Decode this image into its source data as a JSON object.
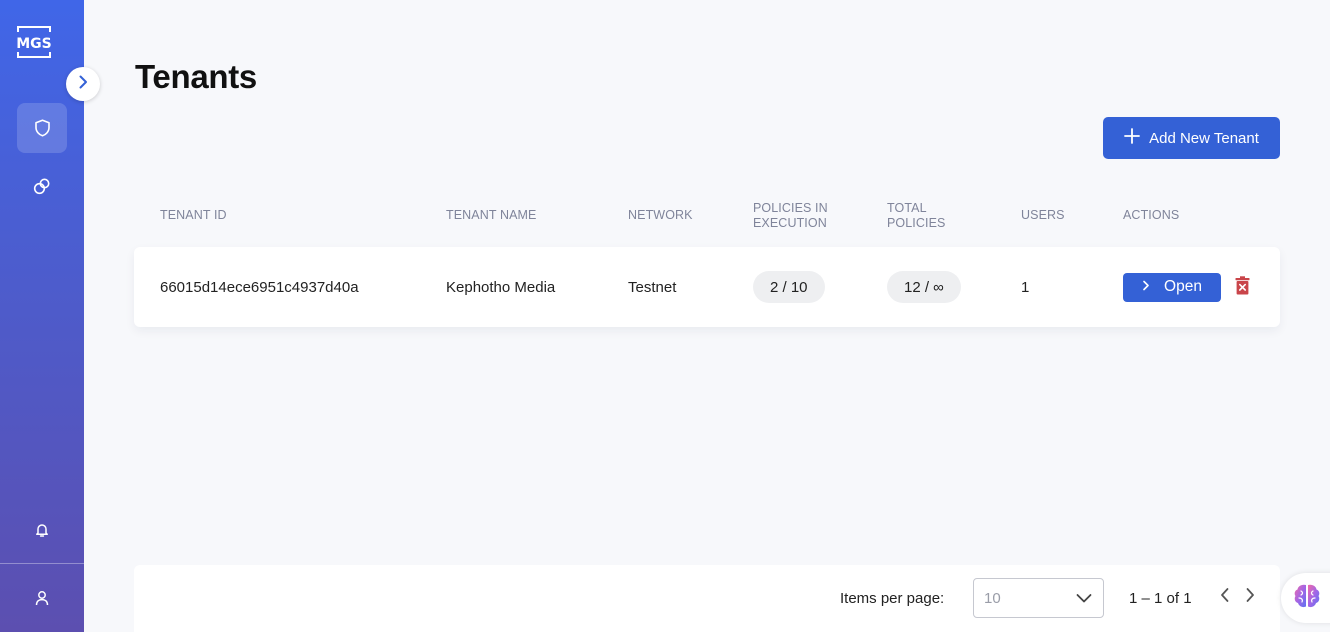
{
  "app": {
    "logo_text": "MGS"
  },
  "sidebar": {
    "items": [
      {
        "icon": "shield-icon",
        "active": true
      },
      {
        "icon": "rings-icon",
        "active": false
      },
      {
        "icon": "bell-icon",
        "active": false
      },
      {
        "icon": "user-icon",
        "active": false
      }
    ]
  },
  "page": {
    "title": "Tenants"
  },
  "toolbar": {
    "add_label": "Add New Tenant"
  },
  "table": {
    "headers": {
      "tenant_id": "TENANT ID",
      "tenant_name": "TENANT NAME",
      "network": "NETWORK",
      "policies_in_execution": [
        "POLICIES IN",
        "EXECUTION"
      ],
      "total_policies": [
        "TOTAL",
        "POLICIES"
      ],
      "users": "USERS",
      "actions": "ACTIONS"
    },
    "rows": [
      {
        "tenant_id": "66015d14ece6951c4937d40a",
        "tenant_name": "Kephotho Media",
        "network": "Testnet",
        "policies_in_execution": "2 / 10",
        "total_policies": "12 / ∞",
        "users": "1",
        "open_label": "Open"
      }
    ]
  },
  "pagination": {
    "items_per_page_label": "Items per page:",
    "items_per_page_value": "10",
    "range": "1 – 1 of 1"
  },
  "colors": {
    "primary": "#3461d6",
    "danger": "#c9454a",
    "sidebar_top": "#4066e8",
    "sidebar_bottom": "#5c4fb0"
  }
}
